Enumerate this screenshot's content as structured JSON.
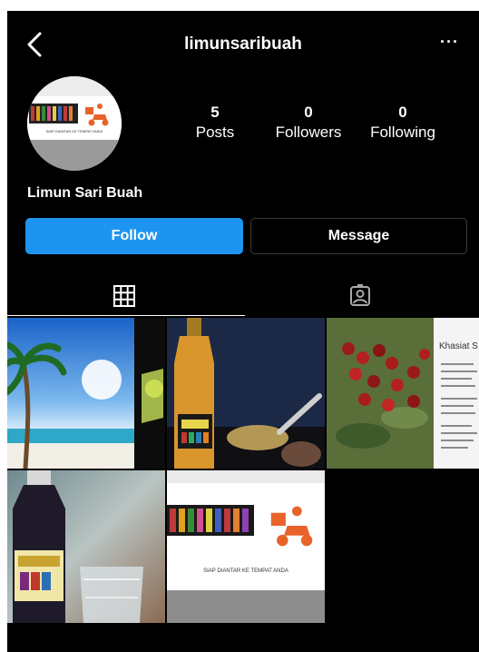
{
  "header": {
    "username": "limunsaribuah",
    "back_icon": "chevron-left-icon",
    "more_label": "···"
  },
  "profile": {
    "display_name": "Limun Sari Buah",
    "avatar_caption": "SIAP DIANTAR KE TEMPAT ANDA",
    "stats": {
      "posts": {
        "value": "5",
        "label": "Posts"
      },
      "followers": {
        "value": "0",
        "label": "Followers"
      },
      "following": {
        "value": "0",
        "label": "Following"
      }
    }
  },
  "actions": {
    "follow_label": "Follow",
    "message_label": "Message"
  },
  "tabs": [
    {
      "name": "grid",
      "icon": "grid-icon",
      "active": true
    },
    {
      "name": "tagged",
      "icon": "tagged-person-icon",
      "active": false
    }
  ],
  "posts": {
    "post3_title": "Khasiat S",
    "post5_caption": "SIAP DIANTAR KE TEMPAT ANDA"
  },
  "colors": {
    "background": "#000000",
    "follow_button": "#1d95f0",
    "accent_orange": "#e8632a"
  }
}
